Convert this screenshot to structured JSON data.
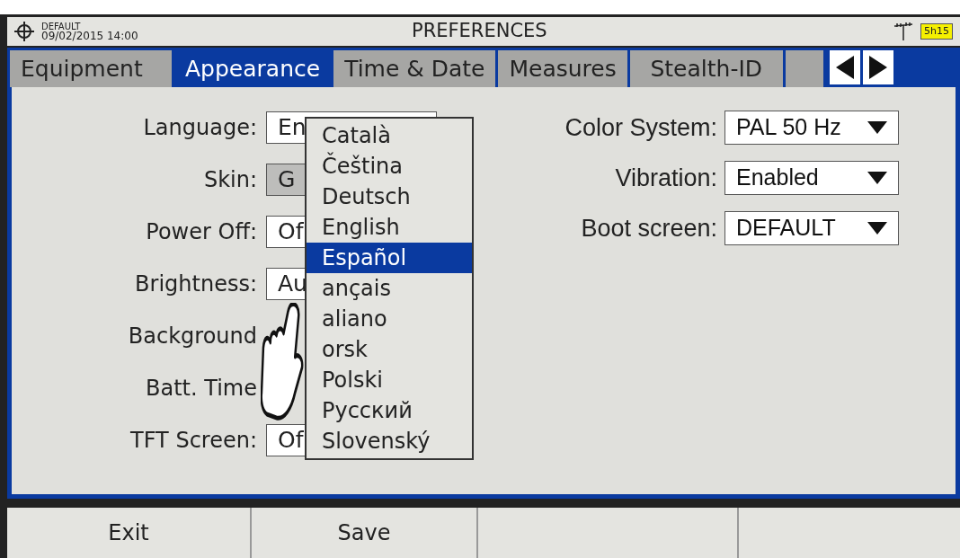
{
  "header": {
    "profile": "DEFAULT",
    "datetime": "09/02/2015 14:00",
    "title": "PREFERENCES",
    "battery": "5h15"
  },
  "tabs": [
    {
      "label": "Equipment",
      "selected": false
    },
    {
      "label": "Appearance",
      "selected": true
    },
    {
      "label": "Time & Date",
      "selected": false
    },
    {
      "label": "Measures",
      "selected": false
    },
    {
      "label": "Stealth-ID",
      "selected": false
    }
  ],
  "left_settings": [
    {
      "label": "Language:",
      "value": "En",
      "kind": "field"
    },
    {
      "label": "Skin:",
      "value": "G",
      "kind": "grey"
    },
    {
      "label": "Power Off:",
      "value": "Of",
      "kind": "field"
    },
    {
      "label": "Brightness:",
      "value": "Au",
      "kind": "field"
    },
    {
      "label": "Background",
      "kind": "hidden"
    },
    {
      "label": "Batt. Time",
      "kind": "hidden"
    },
    {
      "label": "TFT Screen:",
      "value": "Of",
      "kind": "field"
    }
  ],
  "right_settings": [
    {
      "label": "Color System:",
      "value": "PAL 50 Hz"
    },
    {
      "label": "Vibration:",
      "value": "Enabled"
    },
    {
      "label": "Boot screen:",
      "value": "DEFAULT"
    }
  ],
  "language_menu": [
    {
      "label": "Català",
      "selected": false
    },
    {
      "label": "Čeština",
      "selected": false
    },
    {
      "label": "Deutsch",
      "selected": false
    },
    {
      "label": "English",
      "selected": false
    },
    {
      "label": "Español",
      "selected": true
    },
    {
      "label": "ançais",
      "selected": false
    },
    {
      "label": "aliano",
      "selected": false
    },
    {
      "label": "orsk",
      "selected": false
    },
    {
      "label": "Polski",
      "selected": false
    },
    {
      "label": "Русский",
      "selected": false
    },
    {
      "label": "Slovenský",
      "selected": false
    }
  ],
  "softkeys": [
    {
      "label": "Exit"
    },
    {
      "label": "Save"
    }
  ]
}
